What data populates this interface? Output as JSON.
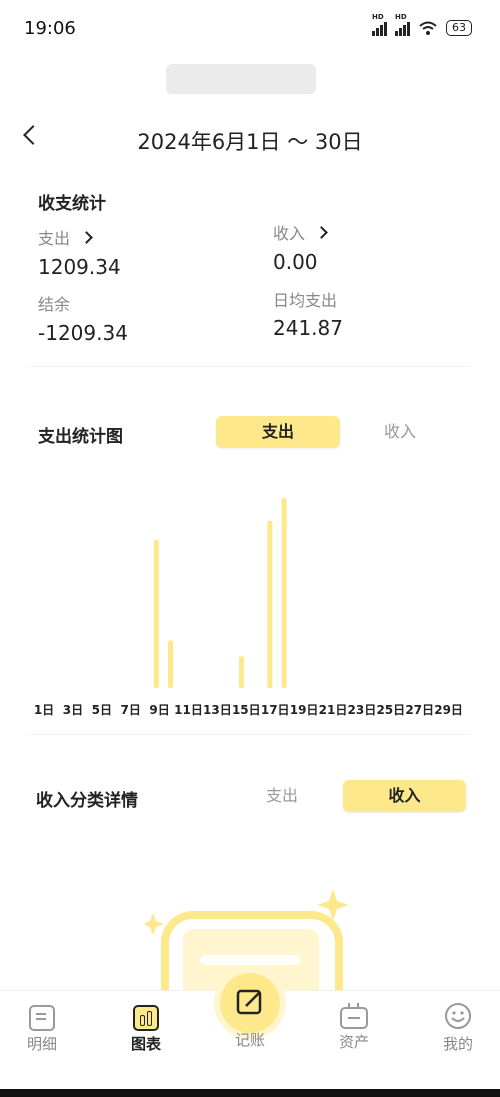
{
  "status_bar": {
    "time": "19:06",
    "battery": "63"
  },
  "header": {
    "date_range": "2024年6月1日 ～ 30日"
  },
  "stats": {
    "title": "收支统计",
    "expense_label": "支出",
    "expense_value": "1209.34",
    "income_label": "收入",
    "income_value": "0.00",
    "balance_label": "结余",
    "balance_value": "-1209.34",
    "daily_avg_label": "日均支出",
    "daily_avg_value": "241.87"
  },
  "chart_section": {
    "title": "支出统计图",
    "toggle_expense": "支出",
    "toggle_income": "收入"
  },
  "chart_data": {
    "type": "bar",
    "categories": [
      "1日",
      "2日",
      "3日",
      "4日",
      "5日",
      "6日",
      "7日",
      "8日",
      "9日",
      "10日",
      "11日",
      "12日",
      "13日",
      "14日",
      "15日",
      "16日",
      "17日",
      "18日",
      "19日",
      "20日",
      "21日",
      "22日",
      "23日",
      "24日",
      "25日",
      "26日",
      "27日",
      "28日",
      "29日",
      "30日"
    ],
    "tick_labels": [
      "1日",
      "3日",
      "5日",
      "7日",
      "9日",
      "11日",
      "13日",
      "15日",
      "17日",
      "19日",
      "21日",
      "23日",
      "25日",
      "27日",
      "29日"
    ],
    "values": [
      0,
      0,
      0,
      0,
      300,
      96,
      0,
      0,
      0,
      0,
      64,
      0,
      338,
      384,
      0,
      0,
      0,
      0,
      0,
      0,
      0,
      0,
      0,
      0,
      0,
      0,
      0,
      0,
      0,
      0
    ],
    "bar_color": "#fde98c",
    "grid": false,
    "legend": "none"
  },
  "category_section": {
    "title": "收入分类详情",
    "toggle_expense": "支出",
    "toggle_income": "收入"
  },
  "nav": {
    "items": [
      {
        "label": "明细",
        "icon": "list-icon"
      },
      {
        "label": "图表",
        "icon": "chart-icon"
      },
      {
        "label": "记账",
        "icon": "edit-icon"
      },
      {
        "label": "资产",
        "icon": "wallet-icon"
      },
      {
        "label": "我的",
        "icon": "smile-icon"
      }
    ]
  },
  "colors": {
    "accent": "#fde98c",
    "accent_light": "#fff6cf"
  }
}
